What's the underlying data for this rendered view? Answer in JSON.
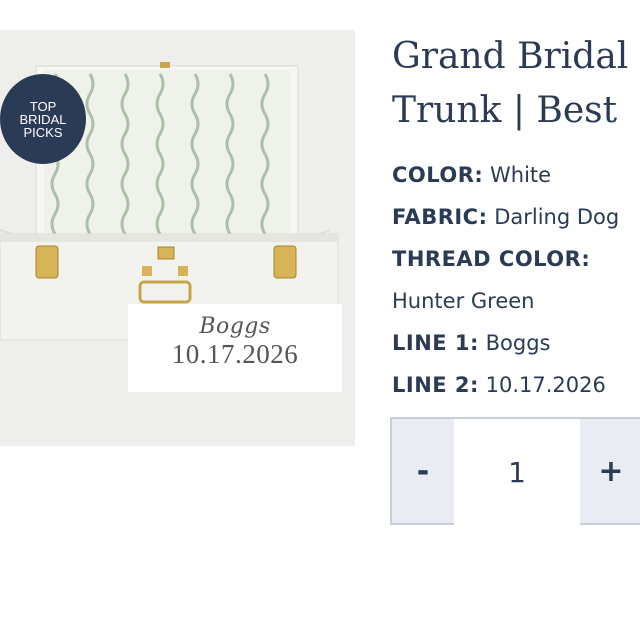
{
  "badge": {
    "line1": "TOP",
    "line2": "BRIDAL",
    "line3": "PICKS"
  },
  "monogram": {
    "name": "Boggs",
    "date": "10.17.2026"
  },
  "product": {
    "title_line1": "Grand Bridal",
    "title_line2": "Trunk | Best"
  },
  "options": [
    {
      "label": "COLOR:",
      "value": "White"
    },
    {
      "label": "FABRIC:",
      "value": "Darling Dog"
    },
    {
      "label": "THREAD COLOR:",
      "value": ""
    },
    {
      "label": "",
      "value": "Hunter Green"
    },
    {
      "label": "LINE 1:",
      "value": "Boggs"
    },
    {
      "label": "LINE 2:",
      "value": "10.17.2026"
    }
  ],
  "quantity": {
    "minus": "-",
    "value": "1",
    "plus": "+"
  }
}
